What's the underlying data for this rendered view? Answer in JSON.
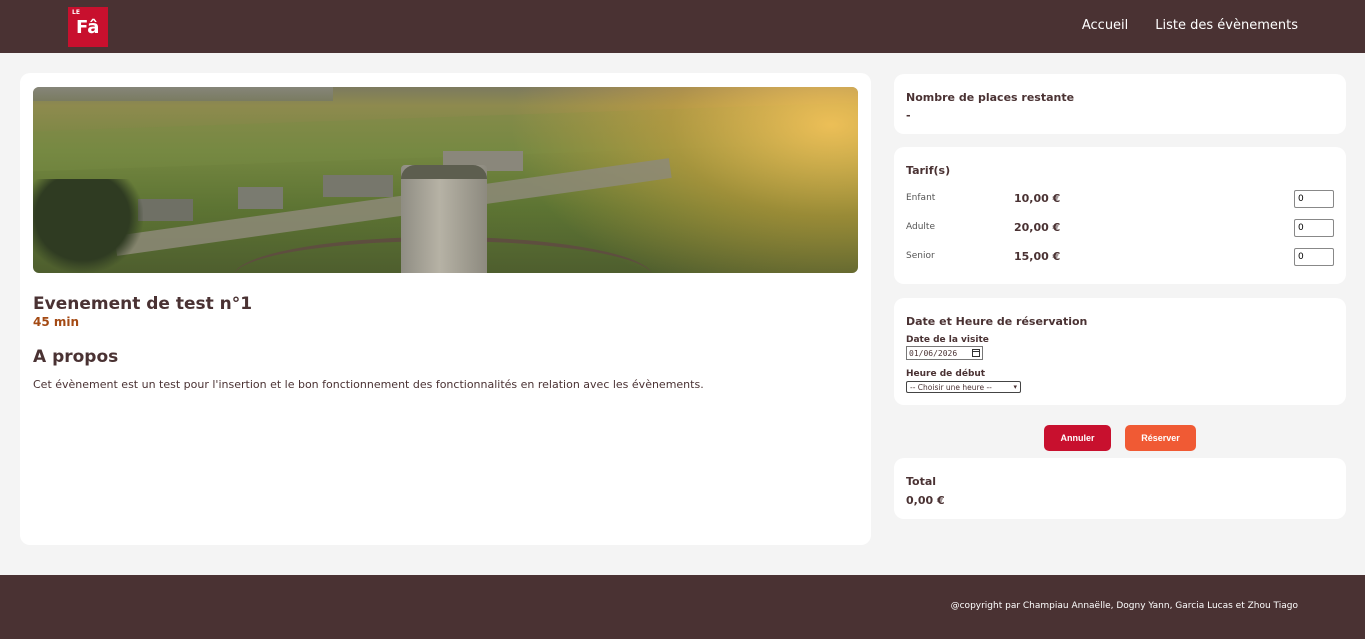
{
  "header": {
    "logo_small": "LE",
    "logo_main": "Fâ",
    "nav": [
      {
        "label": "Accueil"
      },
      {
        "label": "Liste des évènements"
      }
    ]
  },
  "event": {
    "title": "Evenement de test n°1",
    "duration": "45 min",
    "about_heading": "A propos",
    "about_text": "Cet évènement est un test pour l'insertion et le bon fonctionnement des fonctionnalités en relation avec les évènements."
  },
  "places": {
    "label": "Nombre de places restante",
    "value": "-"
  },
  "tarifs": {
    "label": "Tarif(s)",
    "items": [
      {
        "name": "Enfant",
        "price": "10,00 €",
        "qty": "0"
      },
      {
        "name": "Adulte",
        "price": "20,00 €",
        "qty": "0"
      },
      {
        "name": "Senior",
        "price": "15,00 €",
        "qty": "0"
      }
    ]
  },
  "reservation": {
    "label": "Date et Heure de réservation",
    "date_label": "Date de la visite",
    "date_value": "01/06/2026",
    "time_label": "Heure de début",
    "time_value": "-- Choisir une heure --"
  },
  "actions": {
    "cancel": "Annuler",
    "reserve": "Réserver"
  },
  "total": {
    "label": "Total",
    "value": "0,00 €"
  },
  "footer": {
    "copyright": "@copyright par Champiau Annaëlle, Dogny Yann, Garcia Lucas et Zhou Tiago"
  },
  "colors": {
    "brand_dark": "#4a3233",
    "brand_red": "#c8102e",
    "accent_orange": "#f05a34",
    "duration_brown": "#a44a14"
  }
}
